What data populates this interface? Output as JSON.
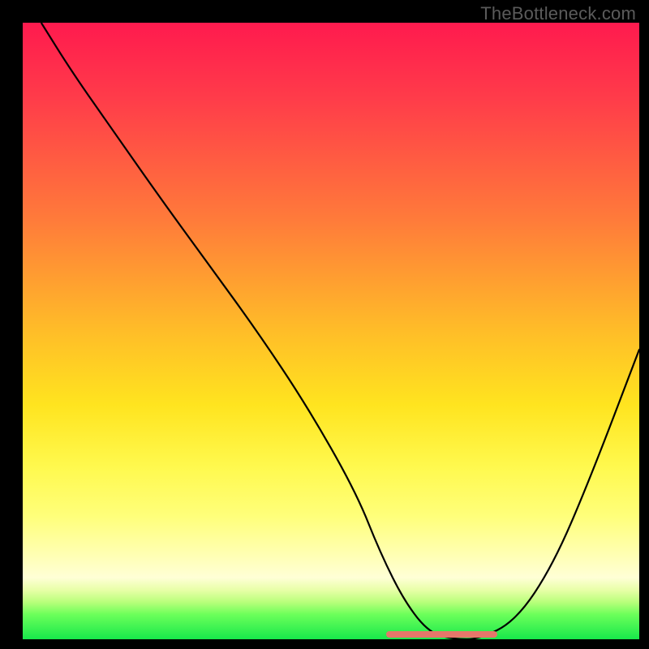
{
  "watermark": "TheBottleneck.com",
  "colors": {
    "frame": "#000000",
    "curve": "#000000",
    "marker": "#e5776a",
    "text": "#5b5b5b"
  },
  "chart_data": {
    "type": "line",
    "title": "",
    "xlabel": "",
    "ylabel": "",
    "xlim": [
      0,
      100
    ],
    "ylim": [
      0,
      100
    ],
    "grid": false,
    "legend": false,
    "series": [
      {
        "name": "curve",
        "x": [
          3,
          8,
          15,
          22,
          30,
          38,
          46,
          54,
          58,
          62,
          66,
          70,
          74,
          80,
          86,
          92,
          100
        ],
        "y": [
          100,
          92,
          82,
          72,
          61,
          50,
          38,
          24,
          14,
          6,
          1,
          0,
          0,
          3,
          12,
          26,
          47
        ]
      }
    ],
    "flat_region_x": [
      59,
      77
    ],
    "background_gradient": [
      {
        "pos": 0,
        "color": "#ff1a4e"
      },
      {
        "pos": 50,
        "color": "#ffbd28"
      },
      {
        "pos": 72,
        "color": "#fff94e"
      },
      {
        "pos": 100,
        "color": "#17e84b"
      }
    ]
  }
}
